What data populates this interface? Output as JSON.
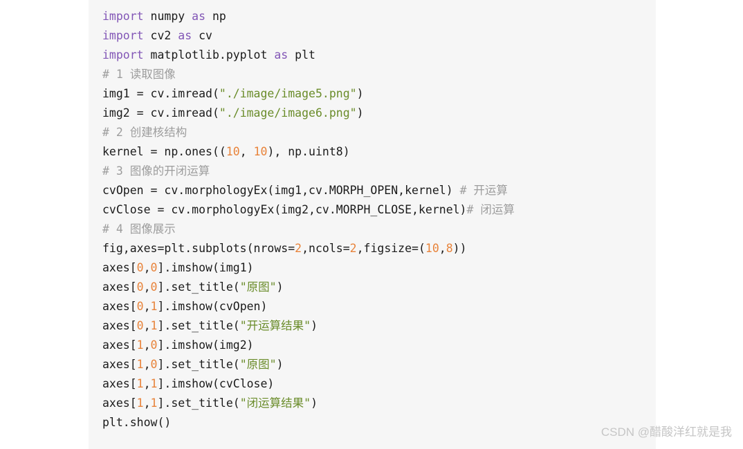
{
  "page": {
    "background_color": "#ffffff"
  },
  "code_block": {
    "background_color": "#f6f6f6",
    "language": "python",
    "colors": {
      "keyword": "#8256b6",
      "string": "#6a8c2a",
      "number": "#e8833a",
      "comment": "#9d9d9d",
      "plain": "#1b1b1b"
    },
    "lines": [
      {
        "index": 1,
        "text": "import numpy as np",
        "tokens": [
          {
            "t": "import",
            "c": "kw"
          },
          {
            "t": " numpy ",
            "c": "plain"
          },
          {
            "t": "as",
            "c": "kw"
          },
          {
            "t": " np",
            "c": "plain"
          }
        ]
      },
      {
        "index": 2,
        "text": "import cv2 as cv",
        "tokens": [
          {
            "t": "import",
            "c": "kw"
          },
          {
            "t": " cv2 ",
            "c": "plain"
          },
          {
            "t": "as",
            "c": "kw"
          },
          {
            "t": " cv",
            "c": "plain"
          }
        ]
      },
      {
        "index": 3,
        "text": "import matplotlib.pyplot as plt",
        "tokens": [
          {
            "t": "import",
            "c": "kw"
          },
          {
            "t": " matplotlib.pyplot ",
            "c": "plain"
          },
          {
            "t": "as",
            "c": "kw"
          },
          {
            "t": " plt",
            "c": "plain"
          }
        ]
      },
      {
        "index": 4,
        "text": "# 1 读取图像",
        "tokens": [
          {
            "t": "# 1 读取图像",
            "c": "cmt"
          }
        ]
      },
      {
        "index": 5,
        "text": "img1 = cv.imread(\"./image/image5.png\")",
        "tokens": [
          {
            "t": "img1 = cv.imread(",
            "c": "plain"
          },
          {
            "t": "\"./image/image5.png\"",
            "c": "str"
          },
          {
            "t": ")",
            "c": "plain"
          }
        ]
      },
      {
        "index": 6,
        "text": "img2 = cv.imread(\"./image/image6.png\")",
        "tokens": [
          {
            "t": "img2 = cv.imread(",
            "c": "plain"
          },
          {
            "t": "\"./image/image6.png\"",
            "c": "str"
          },
          {
            "t": ")",
            "c": "plain"
          }
        ]
      },
      {
        "index": 7,
        "text": "# 2 创建核结构",
        "tokens": [
          {
            "t": "# 2 创建核结构",
            "c": "cmt"
          }
        ]
      },
      {
        "index": 8,
        "text": "kernel = np.ones((10, 10), np.uint8)",
        "tokens": [
          {
            "t": "kernel = np.ones((",
            "c": "plain"
          },
          {
            "t": "10",
            "c": "num"
          },
          {
            "t": ", ",
            "c": "plain"
          },
          {
            "t": "10",
            "c": "num"
          },
          {
            "t": "), np.uint8)",
            "c": "plain"
          }
        ]
      },
      {
        "index": 9,
        "text": "# 3 图像的开闭运算",
        "tokens": [
          {
            "t": "# 3 图像的开闭运算",
            "c": "cmt"
          }
        ]
      },
      {
        "index": 10,
        "text": "cvOpen = cv.morphologyEx(img1,cv.MORPH_OPEN,kernel) # 开运算",
        "tokens": [
          {
            "t": "cvOpen = cv.morphologyEx(img1,cv.MORPH_OPEN,kernel) ",
            "c": "plain"
          },
          {
            "t": "# 开运算",
            "c": "cmt"
          }
        ]
      },
      {
        "index": 11,
        "text": "cvClose = cv.morphologyEx(img2,cv.MORPH_CLOSE,kernel)# 闭运算",
        "tokens": [
          {
            "t": "cvClose = cv.morphologyEx(img2,cv.MORPH_CLOSE,kernel)",
            "c": "plain"
          },
          {
            "t": "# 闭运算",
            "c": "cmt"
          }
        ]
      },
      {
        "index": 12,
        "text": "# 4 图像展示",
        "tokens": [
          {
            "t": "# 4 图像展示",
            "c": "cmt"
          }
        ]
      },
      {
        "index": 13,
        "text": "fig,axes=plt.subplots(nrows=2,ncols=2,figsize=(10,8))",
        "tokens": [
          {
            "t": "fig,axes=plt.subplots(nrows=",
            "c": "plain"
          },
          {
            "t": "2",
            "c": "num"
          },
          {
            "t": ",ncols=",
            "c": "plain"
          },
          {
            "t": "2",
            "c": "num"
          },
          {
            "t": ",figsize=(",
            "c": "plain"
          },
          {
            "t": "10",
            "c": "num"
          },
          {
            "t": ",",
            "c": "plain"
          },
          {
            "t": "8",
            "c": "num"
          },
          {
            "t": "))",
            "c": "plain"
          }
        ]
      },
      {
        "index": 14,
        "text": "axes[0,0].imshow(img1)",
        "tokens": [
          {
            "t": "axes[",
            "c": "plain"
          },
          {
            "t": "0",
            "c": "num"
          },
          {
            "t": ",",
            "c": "plain"
          },
          {
            "t": "0",
            "c": "num"
          },
          {
            "t": "].imshow(img1)",
            "c": "plain"
          }
        ]
      },
      {
        "index": 15,
        "text": "axes[0,0].set_title(\"原图\")",
        "tokens": [
          {
            "t": "axes[",
            "c": "plain"
          },
          {
            "t": "0",
            "c": "num"
          },
          {
            "t": ",",
            "c": "plain"
          },
          {
            "t": "0",
            "c": "num"
          },
          {
            "t": "].set_title(",
            "c": "plain"
          },
          {
            "t": "\"原图\"",
            "c": "str"
          },
          {
            "t": ")",
            "c": "plain"
          }
        ]
      },
      {
        "index": 16,
        "text": "axes[0,1].imshow(cvOpen)",
        "tokens": [
          {
            "t": "axes[",
            "c": "plain"
          },
          {
            "t": "0",
            "c": "num"
          },
          {
            "t": ",",
            "c": "plain"
          },
          {
            "t": "1",
            "c": "num"
          },
          {
            "t": "].imshow(cvOpen)",
            "c": "plain"
          }
        ]
      },
      {
        "index": 17,
        "text": "axes[0,1].set_title(\"开运算结果\")",
        "tokens": [
          {
            "t": "axes[",
            "c": "plain"
          },
          {
            "t": "0",
            "c": "num"
          },
          {
            "t": ",",
            "c": "plain"
          },
          {
            "t": "1",
            "c": "num"
          },
          {
            "t": "].set_title(",
            "c": "plain"
          },
          {
            "t": "\"开运算结果\"",
            "c": "str"
          },
          {
            "t": ")",
            "c": "plain"
          }
        ]
      },
      {
        "index": 18,
        "text": "axes[1,0].imshow(img2)",
        "tokens": [
          {
            "t": "axes[",
            "c": "plain"
          },
          {
            "t": "1",
            "c": "num"
          },
          {
            "t": ",",
            "c": "plain"
          },
          {
            "t": "0",
            "c": "num"
          },
          {
            "t": "].imshow(img2)",
            "c": "plain"
          }
        ]
      },
      {
        "index": 19,
        "text": "axes[1,0].set_title(\"原图\")",
        "tokens": [
          {
            "t": "axes[",
            "c": "plain"
          },
          {
            "t": "1",
            "c": "num"
          },
          {
            "t": ",",
            "c": "plain"
          },
          {
            "t": "0",
            "c": "num"
          },
          {
            "t": "].set_title(",
            "c": "plain"
          },
          {
            "t": "\"原图\"",
            "c": "str"
          },
          {
            "t": ")",
            "c": "plain"
          }
        ]
      },
      {
        "index": 20,
        "text": "axes[1,1].imshow(cvClose)",
        "tokens": [
          {
            "t": "axes[",
            "c": "plain"
          },
          {
            "t": "1",
            "c": "num"
          },
          {
            "t": ",",
            "c": "plain"
          },
          {
            "t": "1",
            "c": "num"
          },
          {
            "t": "].imshow(cvClose)",
            "c": "plain"
          }
        ]
      },
      {
        "index": 21,
        "text": "axes[1,1].set_title(\"闭运算结果\")",
        "tokens": [
          {
            "t": "axes[",
            "c": "plain"
          },
          {
            "t": "1",
            "c": "num"
          },
          {
            "t": ",",
            "c": "plain"
          },
          {
            "t": "1",
            "c": "num"
          },
          {
            "t": "].set_title(",
            "c": "plain"
          },
          {
            "t": "\"闭运算结果\"",
            "c": "str"
          },
          {
            "t": ")",
            "c": "plain"
          }
        ]
      },
      {
        "index": 22,
        "text": "plt.show()",
        "tokens": [
          {
            "t": "plt.show()",
            "c": "plain"
          }
        ]
      }
    ]
  },
  "watermark": {
    "text": "CSDN @醋酸洋红就是我",
    "color": "#c6c6c6"
  }
}
